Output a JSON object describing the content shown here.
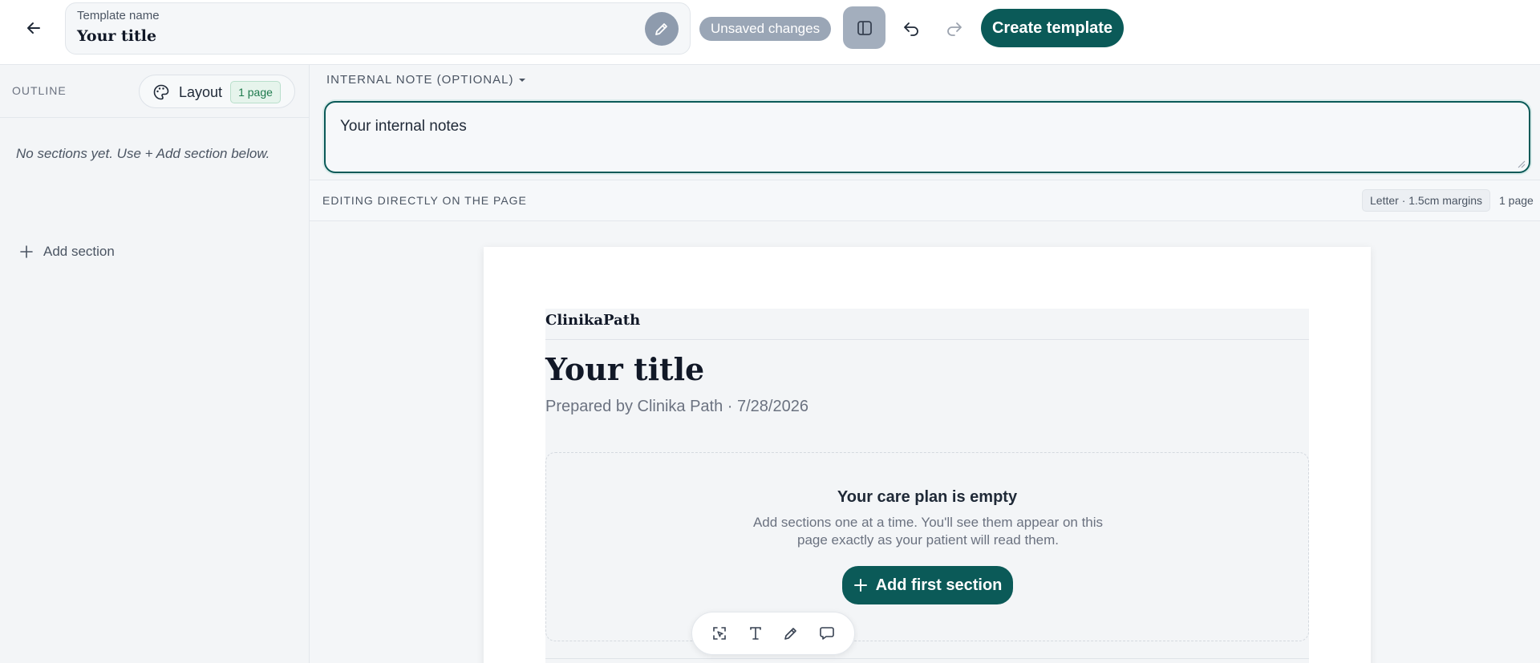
{
  "header": {
    "template_name_label": "Template name",
    "template_name_value": "Your title",
    "unsaved_badge": "Unsaved changes",
    "create_button": "Create template"
  },
  "sidebar": {
    "outline_label": "OUTLINE",
    "layout_button": "Layout",
    "page_badge": "1 page",
    "empty_message": "No sections yet. Use + Add section below.",
    "add_section": "Add section"
  },
  "note": {
    "toggle_label": "INTERNAL NOTE (OPTIONAL)",
    "value": "Your internal notes"
  },
  "edit_strip": {
    "label": "EDITING DIRECTLY ON THE PAGE",
    "format_badge": "Letter · 1.5cm margins",
    "pages": "1 page"
  },
  "page": {
    "brand": "ClinikaPath",
    "title": "Your title",
    "prepared": "Prepared by Clinika Path · 7/28/2026",
    "empty_title": "Your care plan is empty",
    "empty_desc": "Add sections one at a time. You'll see them appear on this page exactly as your patient will read them.",
    "add_first_button": "Add first section"
  },
  "colors": {
    "accent": "#0b5a58",
    "badge_green": "#1e7a4d"
  },
  "icons": {
    "back": "arrow-left-icon",
    "edit": "pencil-icon",
    "panel": "sidebar-panel-icon",
    "undo": "undo-icon",
    "redo": "redo-icon",
    "layout": "palette-icon",
    "add": "plus-icon",
    "toolbar": [
      "select-area-icon",
      "text-icon",
      "pencil-icon",
      "comment-icon"
    ]
  }
}
